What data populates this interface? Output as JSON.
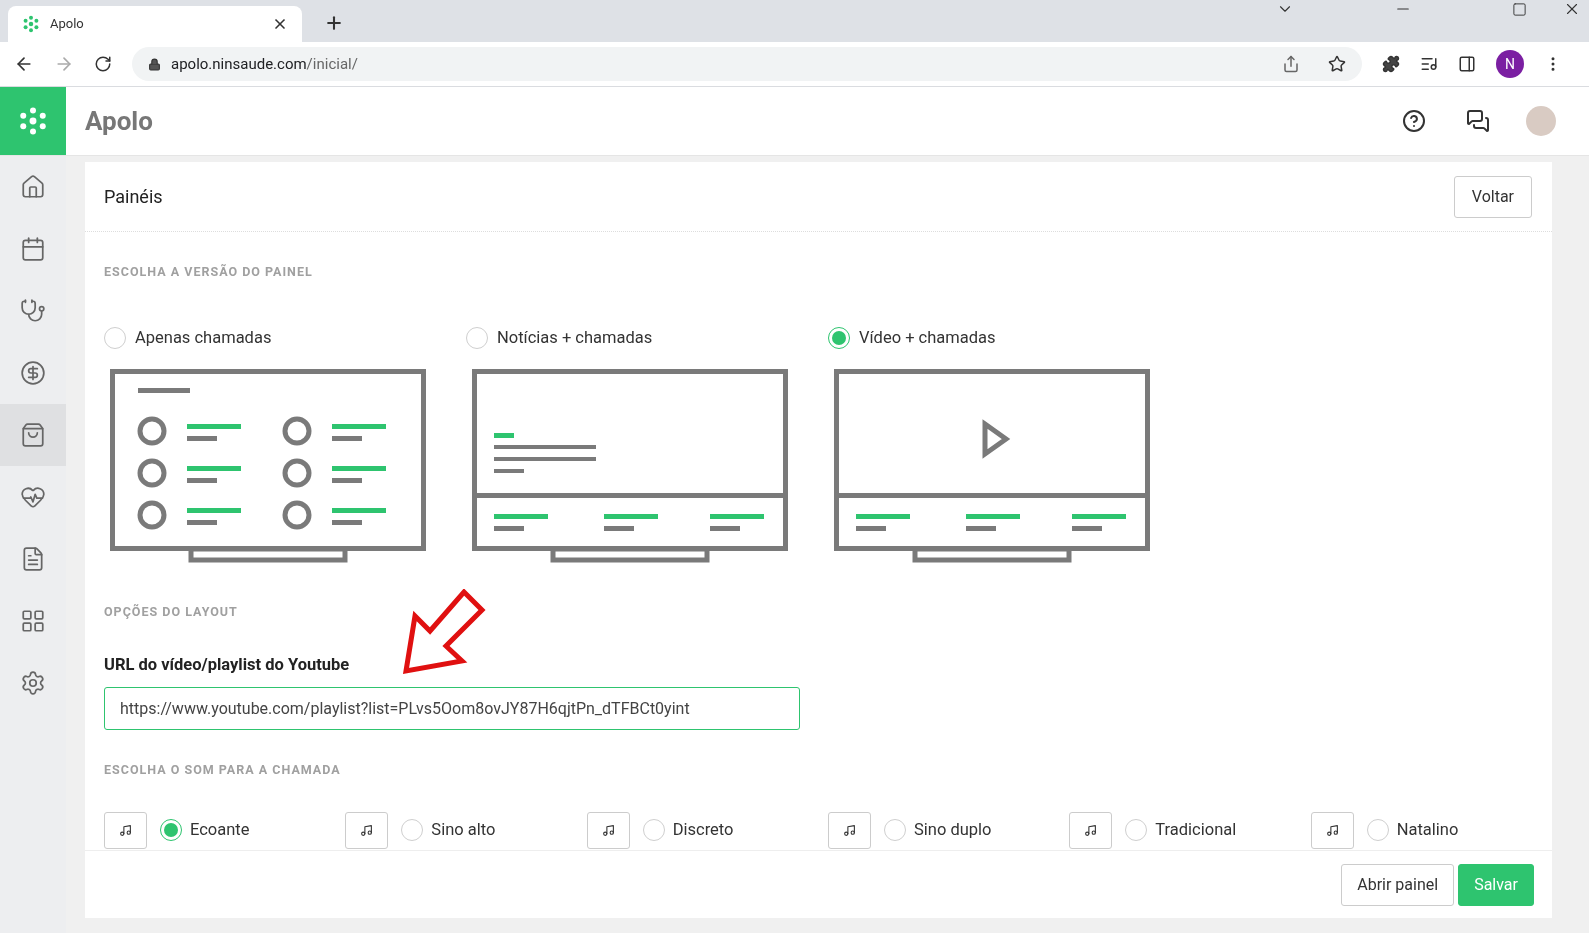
{
  "browser": {
    "tab_title": "Apolo",
    "url_host": "apolo.ninsaude.com",
    "url_path": "/inicial/",
    "profile_initial": "N"
  },
  "app": {
    "title": "Apolo"
  },
  "sidebar": {
    "items": [
      {
        "kind": "home",
        "selected": false
      },
      {
        "kind": "calendar",
        "selected": false
      },
      {
        "kind": "stethoscope",
        "selected": false
      },
      {
        "kind": "money",
        "selected": false
      },
      {
        "kind": "bag",
        "selected": true
      },
      {
        "kind": "heart",
        "selected": false
      },
      {
        "kind": "document",
        "selected": false
      },
      {
        "kind": "grid",
        "selected": false
      },
      {
        "kind": "settings",
        "selected": false
      }
    ]
  },
  "page": {
    "title": "Painéis",
    "back_button": "Voltar",
    "version_heading": "ESCOLHA A VERSÃO DO PAINEL",
    "versions": [
      {
        "label": "Apenas chamadas",
        "kind": "calls",
        "selected": false
      },
      {
        "label": "Notícias + chamadas",
        "kind": "news",
        "selected": false
      },
      {
        "label": "Vídeo + chamadas",
        "kind": "video",
        "selected": true
      }
    ],
    "layout_heading": "OPÇÕES DO LAYOUT",
    "url_label": "URL do vídeo/playlist do Youtube",
    "url_value": "https://www.youtube.com/playlist?list=PLvs5Oom8ovJY87H6qjtPn_dTFBCt0yint",
    "sound_heading": "ESCOLHA O SOM PARA A CHAMADA",
    "sounds": [
      {
        "label": "Ecoante",
        "selected": true
      },
      {
        "label": "Sino alto",
        "selected": false
      },
      {
        "label": "Discreto",
        "selected": false
      },
      {
        "label": "Sino duplo",
        "selected": false
      },
      {
        "label": "Tradicional",
        "selected": false
      },
      {
        "label": "Natalino",
        "selected": false
      }
    ],
    "buttons": [
      {
        "label": "Abrir painel",
        "kind": "secondary"
      },
      {
        "label": "Salvar",
        "kind": "primary"
      }
    ]
  }
}
